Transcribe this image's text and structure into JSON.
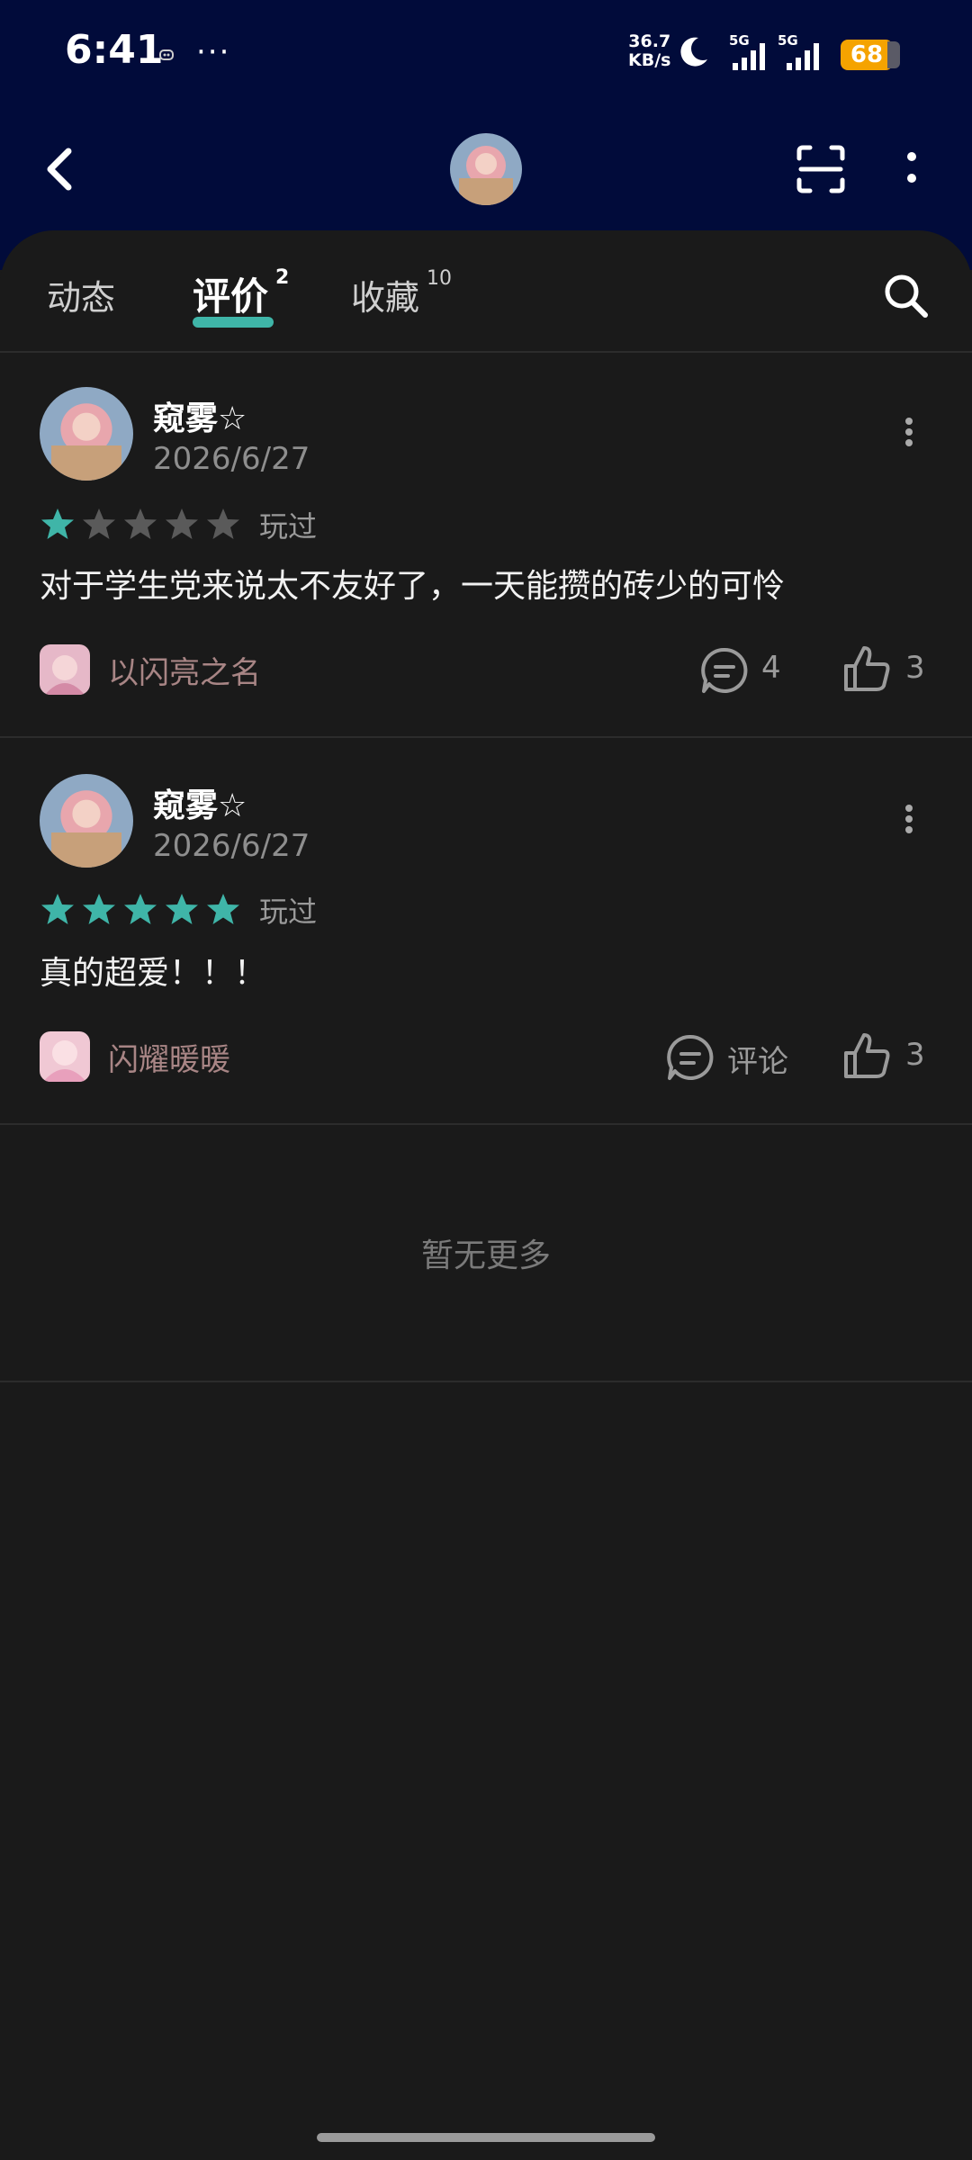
{
  "status_bar": {
    "time": "6:41",
    "dots": "···",
    "net_speed_value": "36.7",
    "net_speed_unit": "KB/s",
    "signal1_label": "5G",
    "signal2_label": "5G",
    "battery": "68",
    "icons": [
      "notification-icon",
      "moon-icon",
      "signal-icon",
      "battery-icon"
    ]
  },
  "header": {
    "icons": [
      "back-icon",
      "profile-avatar",
      "scan-icon",
      "more-vertical-icon"
    ]
  },
  "tabs": [
    {
      "label": "动态",
      "badge": ""
    },
    {
      "label": "评价",
      "badge": "2",
      "active": true
    },
    {
      "label": "收藏",
      "badge": "10"
    }
  ],
  "accent_color": "#3fb5a8",
  "reviews": [
    {
      "user": "窥雾☆",
      "date": "2026/6/27",
      "rating": 1,
      "max_rating": 5,
      "status": "玩过",
      "text": "对于学生党来说太不友好了，一天能攒的砖少的可怜",
      "game": "以闪亮之名",
      "comments": "4",
      "likes": "3"
    },
    {
      "user": "窥雾☆",
      "date": "2026/6/27",
      "rating": 5,
      "max_rating": 5,
      "status": "玩过",
      "text": "真的超爱！！！",
      "game": "闪耀暖暖",
      "comments": "评论",
      "likes": "3"
    }
  ],
  "footer": {
    "no_more": "暂无更多"
  }
}
